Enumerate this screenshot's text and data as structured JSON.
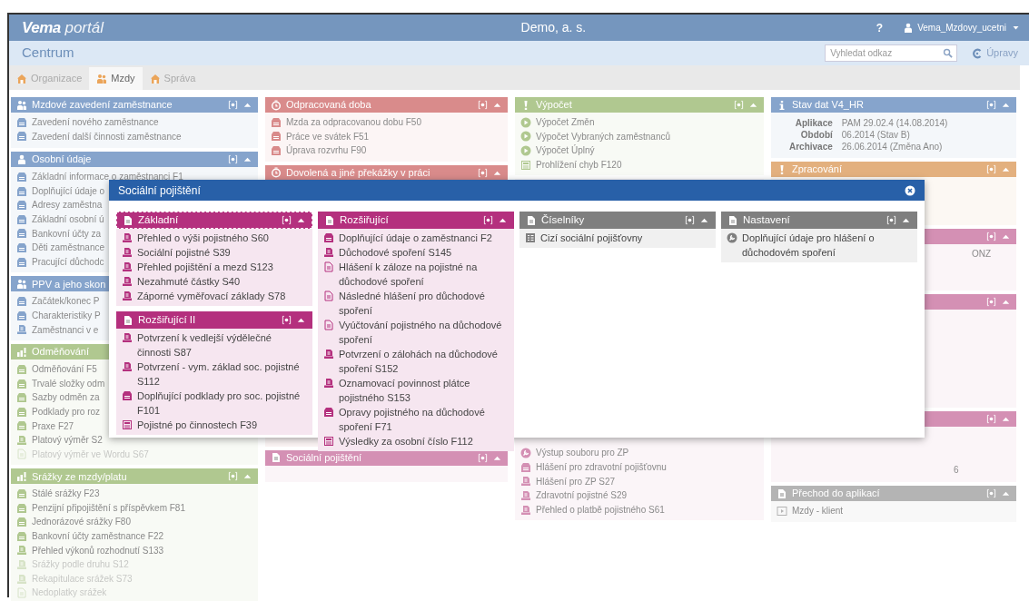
{
  "header": {
    "logo": "Vema",
    "logo_suffix": "portál",
    "company": "Demo, a. s.",
    "help": "?",
    "user": "Vema_Mzdovy_ucetni"
  },
  "toolbar": {
    "title": "Centrum",
    "search": {
      "placeholder": "Vyhledat odkaz"
    },
    "edit_link": "Úpravy"
  },
  "tabs": [
    {
      "label": "Organizace",
      "selected": false
    },
    {
      "label": "Mzdy",
      "selected": true
    },
    {
      "label": "Správa",
      "selected": false
    }
  ],
  "columns": [
    [
      {
        "kind": "list",
        "title": "Mzdové zavedení zaměstnance",
        "color": "#86a4cc",
        "items": [
          {
            "label": "Zavedení nového zaměstnance",
            "kind": "form"
          },
          {
            "label": "Zavedení další činnosti zaměstnance",
            "kind": "form"
          }
        ]
      },
      {
        "kind": "list",
        "title": "Osobní údaje",
        "color": "#86a4cc",
        "items": [
          {
            "label": "Základní informace o zaměstnanci F1",
            "kind": "form"
          },
          {
            "label": "Doplňující údaje o",
            "kind": "form"
          },
          {
            "label": "Adresy zaměstna",
            "kind": "form"
          },
          {
            "label": "Základní osobní ú",
            "kind": "form"
          },
          {
            "label": "Bankovní účty za",
            "kind": "form"
          },
          {
            "label": "Děti zaměstnance",
            "kind": "form"
          },
          {
            "label": "Pracující důchodc",
            "kind": "form"
          }
        ]
      },
      {
        "kind": "list",
        "title": "PPV a jeho skon",
        "color": "#86a4cc",
        "items": [
          {
            "label": "Začátek/konec P",
            "kind": "form"
          },
          {
            "label": "Charakteristiky P",
            "kind": "form"
          },
          {
            "label": "Zaměstnanci v e",
            "kind": "report"
          }
        ]
      },
      {
        "kind": "list",
        "title": "Odměňování",
        "color": "#b0c890",
        "items": [
          {
            "label": "Odměňování F5",
            "kind": "form",
            "disabled": false
          },
          {
            "label": "Trvalé složky odm",
            "kind": "form",
            "disabled": false
          },
          {
            "label": "Sazby odměn za",
            "kind": "form",
            "disabled": false
          },
          {
            "label": "Podklady pro roz",
            "kind": "form",
            "disabled": false
          },
          {
            "label": "Praxe F27",
            "kind": "form",
            "disabled": false
          },
          {
            "label": "Platový výměr S2",
            "kind": "report",
            "disabled": false
          },
          {
            "label": "Platový výměr ve Wordu S67",
            "kind": "document",
            "disabled": true
          }
        ]
      },
      {
        "kind": "list",
        "title": "Srážky ze mzdy/platu",
        "color": "#b0c890",
        "items": [
          {
            "label": "Stálé srážky F23",
            "kind": "form",
            "disabled": false
          },
          {
            "label": "Penzijní připojištění s příspěvkem F81",
            "kind": "form",
            "disabled": false
          },
          {
            "label": "Jednorázové srážky F80",
            "kind": "form",
            "disabled": false
          },
          {
            "label": "Bankovní účty zaměstnance F22",
            "kind": "form",
            "disabled": false
          },
          {
            "label": "Přehled výkonů rozhodnutí S133",
            "kind": "report",
            "disabled": false
          },
          {
            "label": "Srážky podle druhu S12",
            "kind": "report",
            "disabled": true
          },
          {
            "label": "Rekapitulace srážek S73",
            "kind": "report",
            "disabled": true
          },
          {
            "label": "Nedoplatky srážek",
            "kind": "document",
            "disabled": true
          }
        ]
      }
    ],
    [
      {
        "kind": "list",
        "title": "Odpracovaná doba",
        "color": "#d98b8b",
        "items": [
          {
            "label": "Mzda za odpracovanou dobu F50",
            "kind": "form"
          },
          {
            "label": "Práce ve svátek F51",
            "kind": "form"
          },
          {
            "label": "Úprava rozvrhu F90",
            "kind": "form"
          }
        ]
      },
      {
        "kind": "list",
        "title": "Dovolená a jiné překážky v práci",
        "color": "#d98b8b"
      },
      {
        "kind": "list",
        "title": "Sociální pojištění",
        "color": "#d490b4"
      }
    ],
    [
      {
        "kind": "list",
        "title": "Výpočet",
        "color": "#b0c890",
        "items": [
          {
            "label": "Výpočet Změn",
            "kind": "play"
          },
          {
            "label": "Výpočet Vybraných zaměstnanců",
            "kind": "play"
          },
          {
            "label": "Výpočet Úplný",
            "kind": "play"
          },
          {
            "label": "Prohlížení chyb F120",
            "kind": "table"
          }
        ]
      },
      {
        "kind": "continued",
        "color": "#d490b4",
        "items": [
          {
            "label": "Výstup souboru pro ZP",
            "kind": "wrench"
          },
          {
            "label": "Hlášení pro zdravotní pojišťovnu",
            "kind": "form"
          },
          {
            "label": "Hlášení pro ZP S27",
            "kind": "report"
          },
          {
            "label": "Zdravotní pojistné S29",
            "kind": "report"
          },
          {
            "label": "Přehled o platbě pojistného S61",
            "kind": "report"
          }
        ]
      }
    ],
    [
      {
        "kind": "info",
        "title": "Stav dat V4_HR",
        "color": "#86a4cc",
        "rows": [
          {
            "key": "Aplikace",
            "value": "PAM 29.02.4 (14.08.2014)"
          },
          {
            "key": "Období",
            "value": "06.2014 (Stav B)"
          },
          {
            "key": "Archivace",
            "value": "26.06.2014 (Změna Ano)"
          }
        ]
      },
      {
        "kind": "list",
        "title": "Zpracování",
        "color": "#e3b07e"
      },
      {
        "kind": "list",
        "color": "#d490b4",
        "items": [
          {
            "label": "ONZ"
          }
        ]
      },
      {
        "kind": "list",
        "color": "#d490b4"
      },
      {
        "kind": "list",
        "color": "#d490b4",
        "items": [
          {
            "label": "6"
          }
        ]
      },
      {
        "kind": "list",
        "title": "Přechod do aplikací",
        "color": "#b4b4b4",
        "items": [
          {
            "label": "Mzdy - klient",
            "kind": "window"
          }
        ]
      }
    ]
  ],
  "dialog": {
    "title": "Sociální pojištění",
    "columns": [
      [
        {
          "title": "Základní",
          "color": "#b4307e",
          "focused": true,
          "items": [
            {
              "label": "Přehled o výši pojistného S60",
              "kind": "report"
            },
            {
              "label": "Sociální pojistné S39",
              "kind": "report"
            },
            {
              "label": "Přehled pojištění a mezd S123",
              "kind": "report"
            },
            {
              "label": "Nezahmuté částky S40",
              "kind": "report"
            },
            {
              "label": "Záporné vyměřovací základy S78",
              "kind": "report"
            }
          ]
        },
        {
          "title": "Rozšiřující II",
          "color": "#b4307e",
          "focused": false,
          "items": [
            {
              "label": "Potvrzení k vedlejší výdělečné činnosti S87",
              "kind": "report"
            },
            {
              "label": "Potvrzení - vym. základ soc. pojistné S112",
              "kind": "report"
            },
            {
              "label": "Doplňující podklady pro soc. pojistné F101",
              "kind": "form"
            },
            {
              "label": "Pojistné po činnostech F39",
              "kind": "table"
            }
          ]
        }
      ],
      [
        {
          "title": "Rozšiřující",
          "color": "#b4307e",
          "focused": false,
          "items": [
            {
              "label": "Doplňující údaje o zaměstnanci F2",
              "kind": "form"
            },
            {
              "label": "Důchodové spoření S145",
              "kind": "report"
            },
            {
              "label": "Hlášení k záloze na pojistné na důchodové spoření",
              "kind": "document"
            },
            {
              "label": "Následné hlášení pro důchodové spoření",
              "kind": "document"
            },
            {
              "label": "Vyúčtování pojistného na důchodové spoření",
              "kind": "document"
            },
            {
              "label": "Potvrzení o zálohách na důchodové spoření S152",
              "kind": "report"
            },
            {
              "label": "Oznamovací povinnost plátce pojistného S153",
              "kind": "report"
            },
            {
              "label": "Opravy pojistného na důchodové spoření F71",
              "kind": "form"
            },
            {
              "label": "Výsledky za osobní číslo F112",
              "kind": "table"
            }
          ]
        }
      ],
      [
        {
          "title": "Číselníky",
          "color": "#7f7f7f",
          "focused": false,
          "items": [
            {
              "label": "Cizí sociální pojišťovny",
              "kind": "list"
            }
          ]
        }
      ],
      [
        {
          "title": "Nastavení",
          "color": "#7f7f7f",
          "focused": false,
          "items": [
            {
              "label": "Doplňující údaje pro hlášení o důchodovém spoření",
              "kind": "wrench"
            }
          ]
        }
      ]
    ]
  }
}
